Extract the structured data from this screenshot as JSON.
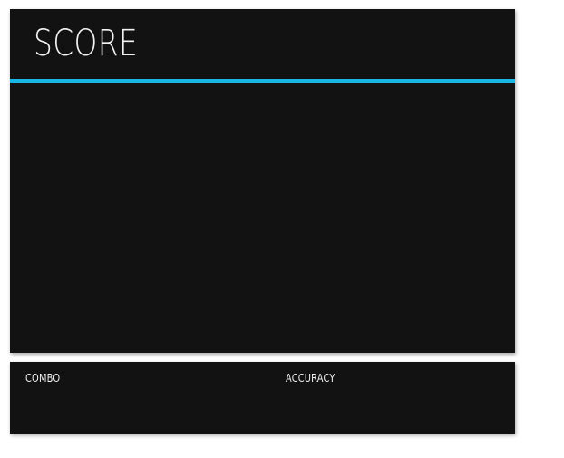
{
  "score_panel": {
    "title": "SCORE",
    "accent_color": "#19b7e6",
    "background_color": "#121212"
  },
  "stats_panel": {
    "combo_label": "COMBO",
    "accuracy_label": "ACCURACY"
  }
}
